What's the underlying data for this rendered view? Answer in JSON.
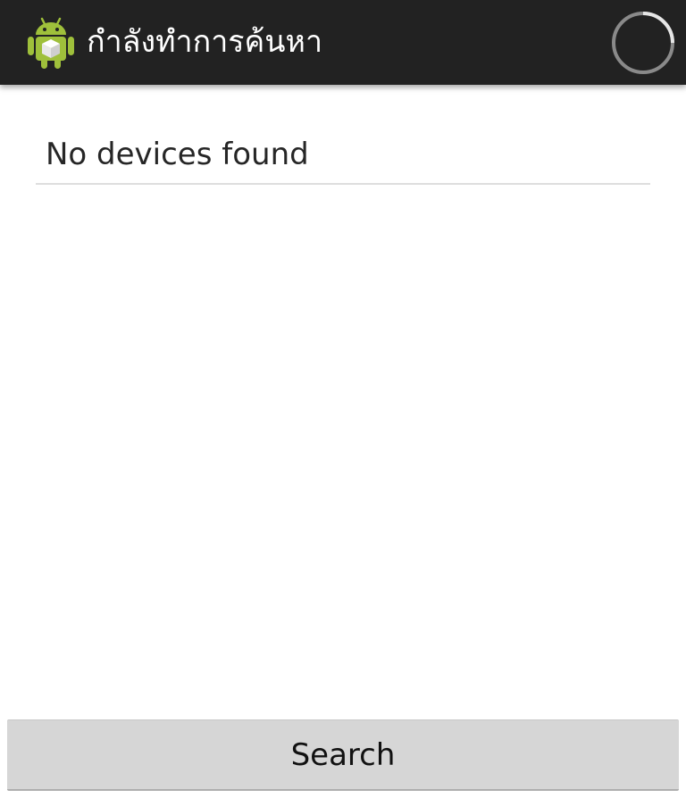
{
  "action_bar": {
    "app_icon": "android-app-icon",
    "title": "กำลังทำการค้นหา",
    "progress_indicator": "loading-spinner-icon",
    "background_color": "#222222"
  },
  "device_list": {
    "empty_text": "No devices found"
  },
  "footer": {
    "search_label": "Search"
  },
  "colors": {
    "android_green": "#9fc03b",
    "button_gray": "#d6d6d6",
    "divider": "#dedede"
  }
}
